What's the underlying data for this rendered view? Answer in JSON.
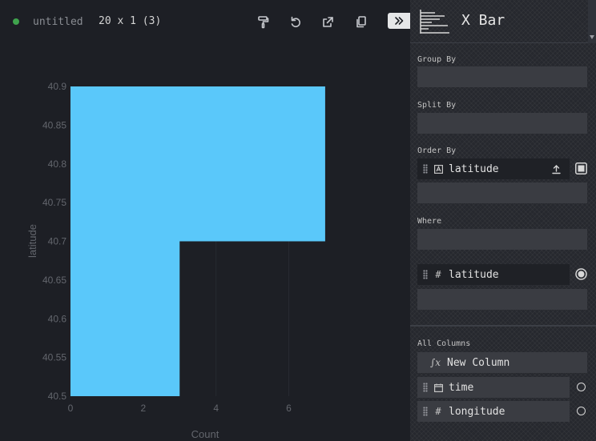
{
  "topbar": {
    "table_name": "untitled",
    "dimensions": "20 x 1 (3)",
    "status_color": "#3fa34d",
    "icons": [
      "paint-roller-icon",
      "undo-icon",
      "export-icon",
      "copy-icon",
      "collapse-chevrons-icon"
    ]
  },
  "plugin": {
    "name": "X Bar",
    "icon": "x-bar-chart-icon"
  },
  "config": {
    "group_by_label": "Group By",
    "split_by_label": "Split By",
    "order_by_label": "Order By",
    "order_by_column": "latitude",
    "where_label": "Where",
    "where_column": "latitude",
    "all_columns_label": "All Columns",
    "new_column_label": "New Column",
    "columns": [
      {
        "name": "time",
        "type_icon": "calendar-icon"
      },
      {
        "name": "longitude",
        "type_icon": "#"
      }
    ]
  },
  "chart_data": {
    "type": "bar",
    "orientation": "horizontal",
    "xlabel": "Count",
    "ylabel": "latitude",
    "xlim": [
      0,
      7.2
    ],
    "ylim": [
      40.5,
      40.9
    ],
    "xticks": [
      "0",
      "2",
      "4",
      "6"
    ],
    "yticks": [
      "40.5",
      "40.55",
      "40.6",
      "40.65",
      "40.7",
      "40.75",
      "40.8",
      "40.85",
      "40.9"
    ],
    "bars": [
      {
        "y0": 40.5,
        "y1": 40.7,
        "value": 3
      },
      {
        "y0": 40.7,
        "y1": 40.9,
        "value": 7
      }
    ],
    "bar_color": "#5ac8fa",
    "grid": true
  }
}
